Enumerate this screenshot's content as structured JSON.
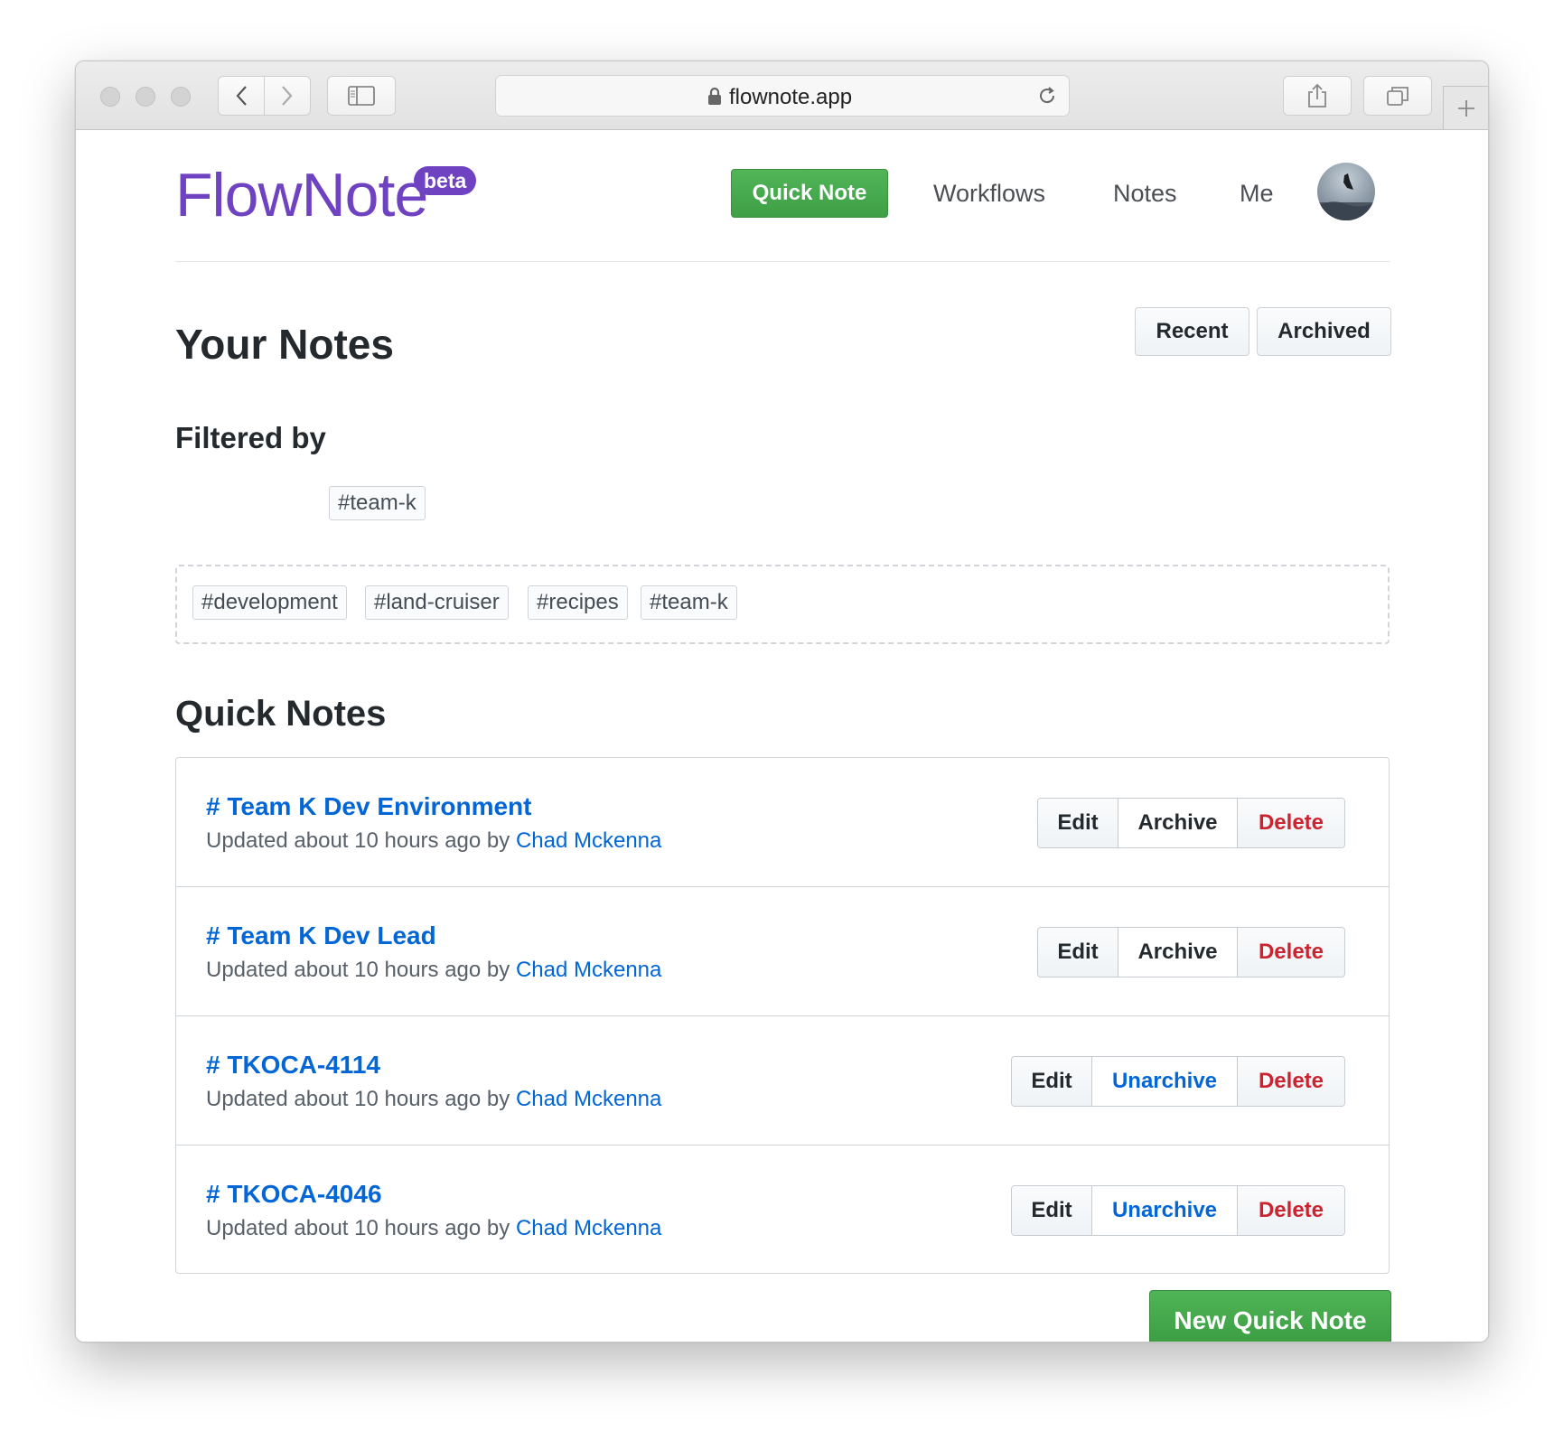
{
  "browser": {
    "url": "flownote.app"
  },
  "header": {
    "logo": "FlowNote",
    "badge": "beta",
    "quick_note_label": "Quick Note",
    "nav": [
      "Workflows",
      "Notes",
      "Me"
    ]
  },
  "page": {
    "title": "Your Notes",
    "filter_buttons": [
      "Recent",
      "Archived"
    ],
    "filtered_by_label": "Filtered by",
    "active_filter": "#team-k",
    "tags": [
      "#development",
      "#land-cruiser",
      "#recipes",
      "#team-k"
    ],
    "section_title": "Quick Notes",
    "notes": [
      {
        "title": "# Team K Dev Environment",
        "meta_prefix": "Updated about 10 hours ago by ",
        "author": "Chad Mckenna",
        "actions": [
          "Edit",
          "Archive",
          "Delete"
        ]
      },
      {
        "title": "# Team K Dev Lead",
        "meta_prefix": "Updated about 10 hours ago by ",
        "author": "Chad Mckenna",
        "actions": [
          "Edit",
          "Archive",
          "Delete"
        ]
      },
      {
        "title": "# TKOCA-4114",
        "meta_prefix": "Updated about 10 hours ago by ",
        "author": "Chad Mckenna",
        "actions": [
          "Edit",
          "Unarchive",
          "Delete"
        ]
      },
      {
        "title": "# TKOCA-4046",
        "meta_prefix": "Updated about 10 hours ago by ",
        "author": "Chad Mckenna",
        "actions": [
          "Edit",
          "Unarchive",
          "Delete"
        ]
      }
    ],
    "new_button": "New Quick Note"
  },
  "colors": {
    "brand": "#6f42c1",
    "primary_green": "#43a047",
    "link": "#0366d6",
    "danger": "#cb2431"
  },
  "icons": [
    "back-icon",
    "forward-icon",
    "sidebar-icon",
    "lock-icon",
    "reload-icon",
    "share-icon",
    "tabs-icon",
    "plus-icon"
  ]
}
